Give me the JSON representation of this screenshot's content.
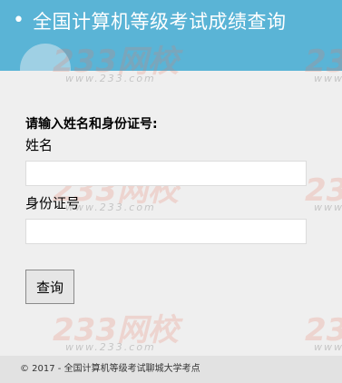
{
  "header": {
    "bullet": "•",
    "title": "全国计算机等级考试成绩查询"
  },
  "form": {
    "heading": "请输入姓名和身份证号:",
    "name_label": "姓名",
    "name_value": "",
    "id_label": "身份证号",
    "id_value": "",
    "submit_label": "查询"
  },
  "footer": {
    "copyright": "© 2017 - 全国计算机等级考试聊城大学考点"
  },
  "watermark": {
    "brand": "233网校",
    "site": "www.233.com",
    "color": "#e8785f"
  },
  "colors": {
    "header_bg": "#5ab4d6",
    "page_bg": "#efefef",
    "footer_bg": "#e2e2e2"
  }
}
